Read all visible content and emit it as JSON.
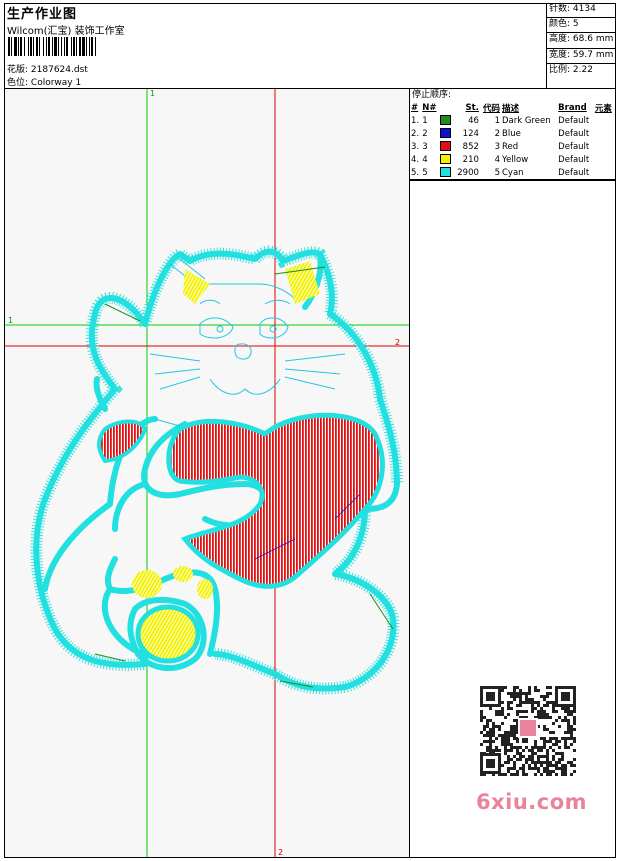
{
  "header": {
    "title": "生产作业图",
    "company": "Wilcom(汇宝) 装饰工作室",
    "design_label": "花版:",
    "design_value": "2187624.dst",
    "colorway_label": "色位:",
    "colorway_value": "Colorway 1"
  },
  "stats": [
    {
      "label": "针数:",
      "value": "4134"
    },
    {
      "label": "颜色:",
      "value": "5"
    },
    {
      "label": "高度:",
      "value": "68.6 mm"
    },
    {
      "label": "宽度:",
      "value": "59.7 mm"
    },
    {
      "label": "比例:",
      "value": "2.22"
    }
  ],
  "guides": {
    "v1": "1",
    "h1": "1",
    "h2": "2",
    "v2": "2"
  },
  "thread_table": {
    "title": "停止顺序:",
    "columns": [
      "#",
      "N#",
      "St.",
      "代码",
      "描述",
      "Brand",
      "元素"
    ],
    "rows": [
      {
        "idx": "1.",
        "n": "1",
        "color": "#1e8c1e",
        "st": "46",
        "code": "1",
        "desc": "Dark Green",
        "brand": "Default"
      },
      {
        "idx": "2.",
        "n": "2",
        "color": "#1010d0",
        "st": "124",
        "code": "2",
        "desc": "Blue",
        "brand": "Default"
      },
      {
        "idx": "3.",
        "n": "3",
        "color": "#e01010",
        "st": "852",
        "code": "3",
        "desc": "Red",
        "brand": "Default"
      },
      {
        "idx": "4.",
        "n": "4",
        "color": "#f2f200",
        "st": "210",
        "code": "4",
        "desc": "Yellow",
        "brand": "Default"
      },
      {
        "idx": "5.",
        "n": "5",
        "color": "#22e0e0",
        "st": "2900",
        "code": "5",
        "desc": "Cyan",
        "brand": "Default"
      }
    ]
  },
  "watermark": {
    "logo": "6xiu.com"
  }
}
